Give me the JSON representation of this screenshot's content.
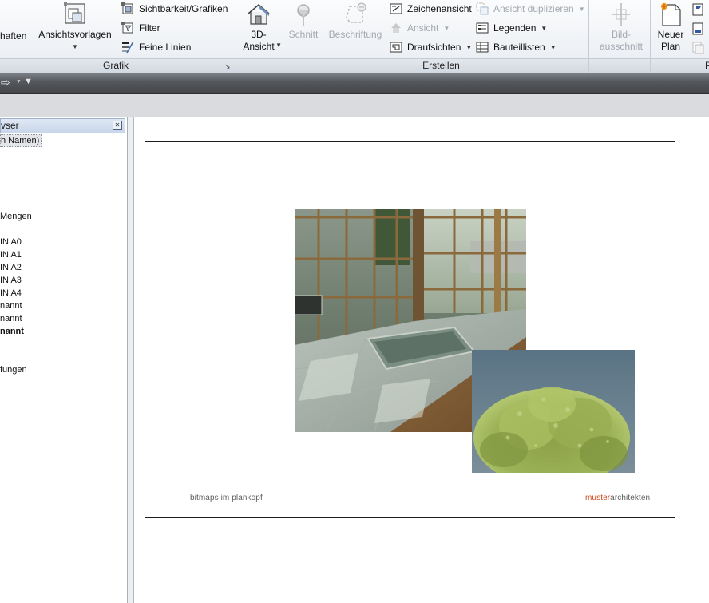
{
  "ribbon": {
    "eigenschaften_label": "haften",
    "ansichtsvorlagen_label": "Ansichtsvorlagen",
    "sichtbarkeit_label": "Sichtbarkeit/Grafiken",
    "filter_label": "Filter",
    "feine_linien_label": "Feine Linien",
    "grafik_panel_title": "Grafik",
    "ansicht3d_line1": "3D-",
    "ansicht3d_line2": "Ansicht",
    "schnitt_label": "Schnitt",
    "beschriftung_label": "Beschriftung",
    "zeichenansicht_label": "Zeichenansicht",
    "ansicht_label": "Ansicht",
    "draufsichten_label": "Draufsichten",
    "ansicht_duplizieren_label": "Ansicht duplizieren",
    "legenden_label": "Legenden",
    "bauteillisten_label": "Bauteillisten",
    "erstellen_panel_title": "Erstellen",
    "bildausschnitt_line1": "Bild-",
    "bildausschnitt_line2": "ausschnitt",
    "neuer_plan_line1": "Neuer",
    "neuer_plan_line2": "Plan",
    "cut_panel_title": "P"
  },
  "browser": {
    "title": "vser",
    "items": [
      {
        "label": "h Namen)",
        "selected": true,
        "bold": false
      },
      {
        "label": "Mengen",
        "selected": false,
        "bold": false
      },
      {
        "label": "IN A0",
        "selected": false,
        "bold": false
      },
      {
        "label": "IN A1",
        "selected": false,
        "bold": false
      },
      {
        "label": "IN A2",
        "selected": false,
        "bold": false
      },
      {
        "label": "IN A3",
        "selected": false,
        "bold": false
      },
      {
        "label": "IN A4",
        "selected": false,
        "bold": false
      },
      {
        "label": "nannt",
        "selected": false,
        "bold": false
      },
      {
        "label": "nannt",
        "selected": false,
        "bold": false
      },
      {
        "label": "nannt",
        "selected": false,
        "bold": true
      },
      {
        "label": "fungen",
        "selected": false,
        "bold": false
      }
    ]
  },
  "sheet": {
    "footer_left": "bitmaps im plankopf",
    "footer_right_accent": "muster",
    "footer_right_rest": "architekten"
  },
  "colors": {
    "accent": "#d2461c",
    "ribbon_bg": "#eef1f5",
    "toolbar_dark": "#4a4c4f"
  }
}
